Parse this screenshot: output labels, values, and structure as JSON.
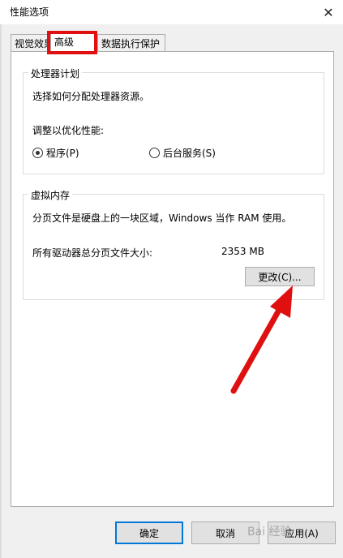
{
  "window": {
    "title": "性能选项",
    "close_glyph": "✕"
  },
  "tabs": [
    {
      "label": "视觉效果",
      "active": false
    },
    {
      "label": "高级",
      "active": true
    },
    {
      "label": "数据执行保护",
      "active": false
    }
  ],
  "processor": {
    "group_title": "处理器计划",
    "description": "选择如何分配处理器资源。",
    "optimize_label": "调整以优化性能:",
    "options": [
      {
        "label": "程序(P)",
        "checked": true
      },
      {
        "label": "后台服务(S)",
        "checked": false
      }
    ]
  },
  "virtual_memory": {
    "group_title": "虚拟内存",
    "description": "分页文件是硬盘上的一块区域，Windows 当作 RAM 使用。",
    "total_label": "所有驱动器总分页文件大小:",
    "total_value": "2353 MB",
    "change_button": "更改(C)..."
  },
  "footer": {
    "ok": "确定",
    "cancel": "取消",
    "apply": "应用(A)"
  },
  "watermark": "Bai 经验",
  "colors": {
    "annotation_red": "#e01010",
    "accent_blue": "#0078d7"
  }
}
